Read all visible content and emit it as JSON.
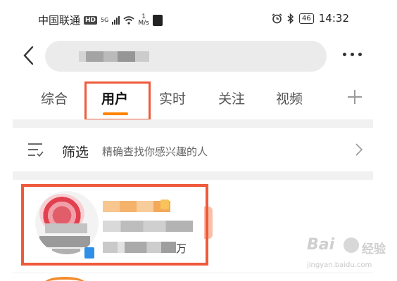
{
  "status_bar": {
    "carrier": "中国联通",
    "hd": "HD",
    "network": "5G",
    "speed_value": "1",
    "speed_unit": "M/s",
    "battery": "46",
    "time": "14:32"
  },
  "header": {
    "search_query": "",
    "icons": {
      "back": "chevron-left-icon",
      "more": "more-dots-icon"
    }
  },
  "tabs": [
    {
      "label": "综合",
      "active": false
    },
    {
      "label": "用户",
      "active": true
    },
    {
      "label": "实时",
      "active": false
    },
    {
      "label": "关注",
      "active": false
    },
    {
      "label": "视频",
      "active": false
    }
  ],
  "filter": {
    "title": "筛选",
    "subtitle": "精确查找你感兴趣的人"
  },
  "result": {
    "fans_unit": "万"
  },
  "watermark": {
    "logo": "Bai",
    "cn": "经验",
    "url": "jingyan.baidu.com"
  },
  "colors": {
    "accent": "#ff8200",
    "highlight": "#ef5a3c",
    "separator": "#f1f1f1"
  }
}
